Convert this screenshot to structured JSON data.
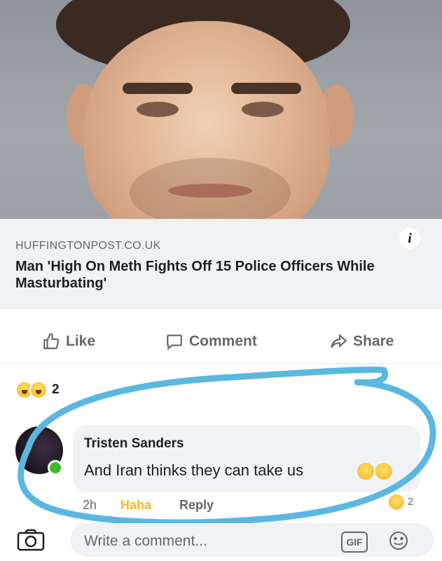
{
  "post": {
    "image_alt": "man portrait photo",
    "link": {
      "domain": "HUFFINGTONPOST.CO.UK",
      "headline": "Man 'High On Meth Fights Off 15 Police Officers While Masturbating'",
      "info_icon": "i"
    },
    "actions": [
      {
        "label": "Like",
        "icon": "thumbs-up-icon"
      },
      {
        "label": "Comment",
        "icon": "speech-bubble-icon"
      },
      {
        "label": "Share",
        "icon": "share-arrow-icon"
      }
    ],
    "reactions": {
      "icons": [
        "haha-emoji-icon",
        "wow-emoji-icon"
      ],
      "count": "2"
    }
  },
  "comment": {
    "author": "Tristen Sanders",
    "text": "And Iran thinks they can take us",
    "time": "2h",
    "reaction_label": "Haha",
    "reply_label": "Reply",
    "reaction_count": "2"
  },
  "composer": {
    "placeholder": "Write a comment...",
    "gif_label": "GIF"
  },
  "colors": {
    "annotation_circle": "#5ab8e0",
    "haha": "#f7b928",
    "text_secondary": "#65676b"
  }
}
